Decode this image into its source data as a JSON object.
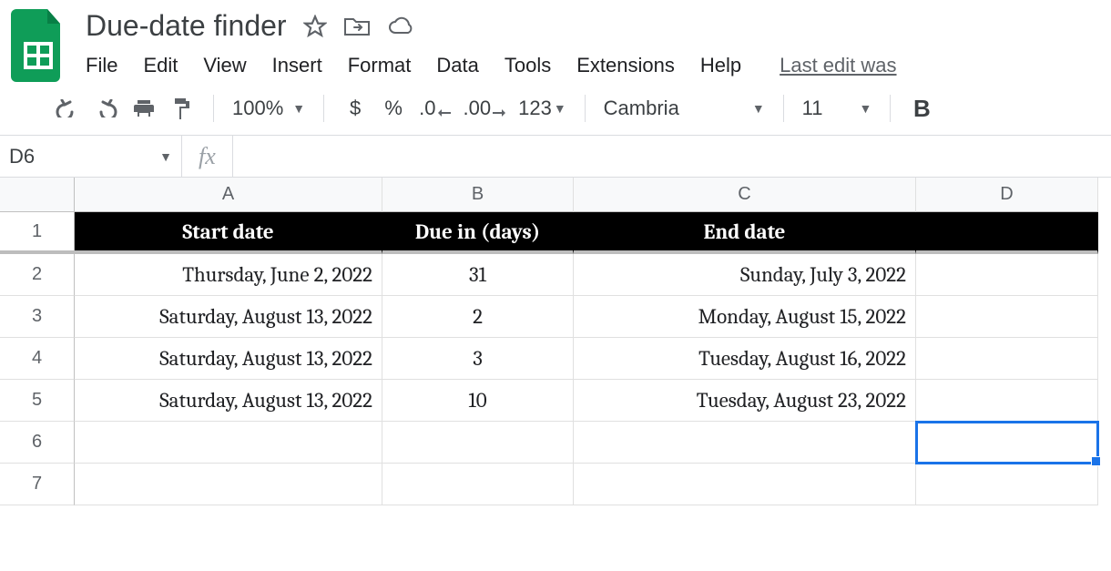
{
  "doc": {
    "title": "Due-date finder"
  },
  "menu": {
    "file": "File",
    "edit": "Edit",
    "view": "View",
    "insert": "Insert",
    "format": "Format",
    "data": "Data",
    "tools": "Tools",
    "extensions": "Extensions",
    "help": "Help",
    "last_edit": "Last edit was"
  },
  "toolbar": {
    "zoom": "100%",
    "currency": "$",
    "percent": "%",
    "dec_dec": ".0",
    "inc_dec": ".00",
    "num_format": "123",
    "font": "Cambria",
    "font_size": "11",
    "bold": "B"
  },
  "formula": {
    "name_box": "D6",
    "fx_label": "fx",
    "value": ""
  },
  "columns": [
    "A",
    "B",
    "C",
    "D"
  ],
  "row_numbers": [
    "1",
    "2",
    "3",
    "4",
    "5",
    "6",
    "7"
  ],
  "headers": {
    "a": "Start date",
    "b": "Due in (days)",
    "c": "End date",
    "d": ""
  },
  "rows": [
    {
      "a": "Thursday, June 2, 2022",
      "b": "31",
      "c": "Sunday, July 3, 2022",
      "d": ""
    },
    {
      "a": "Saturday, August 13, 2022",
      "b": "2",
      "c": "Monday, August 15, 2022",
      "d": ""
    },
    {
      "a": "Saturday, August 13, 2022",
      "b": "3",
      "c": "Tuesday, August 16, 2022",
      "d": ""
    },
    {
      "a": "Saturday, August 13, 2022",
      "b": "10",
      "c": "Tuesday, August 23, 2022",
      "d": ""
    },
    {
      "a": "",
      "b": "",
      "c": "",
      "d": ""
    },
    {
      "a": "",
      "b": "",
      "c": "",
      "d": ""
    }
  ],
  "selected_cell": "D6"
}
